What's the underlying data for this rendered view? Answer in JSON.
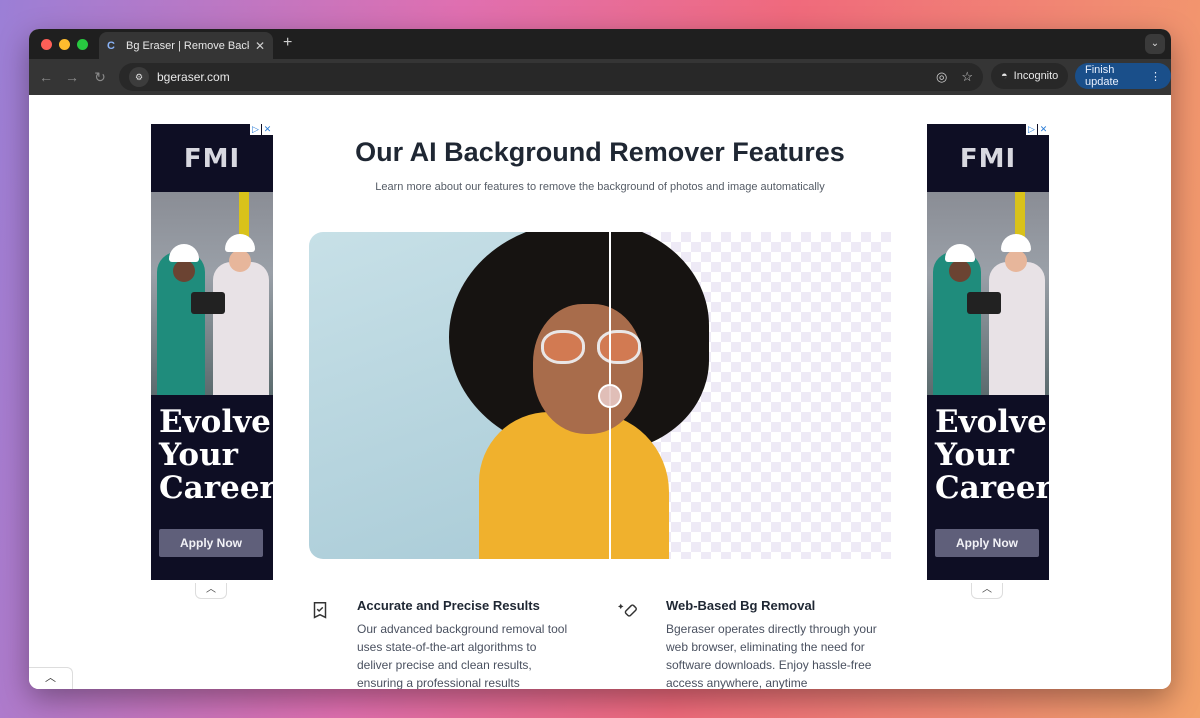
{
  "browser": {
    "tab_title": "Bg Eraser | Remove Backgrou",
    "tab_close": "✕",
    "new_tab": "+",
    "url": "bgeraser.com",
    "incognito_label": "Incognito",
    "finish_update_label": "Finish update"
  },
  "page": {
    "title": "Our AI Background Remover Features",
    "subtitle": "Learn more about our features to remove the background of photos and image automatically",
    "features": [
      {
        "icon": "badge-check-icon",
        "title": "Accurate and Precise Results",
        "text": "Our advanced background removal tool uses state-of-the-art algorithms to deliver precise and clean results, ensuring a professional results"
      },
      {
        "icon": "magic-eraser-icon",
        "title": "Web-Based Bg Removal",
        "text": "Bgeraser operates directly through your web browser, eliminating the need for software downloads. Enjoy hassle-free access anywhere, anytime"
      }
    ]
  },
  "ads": {
    "left": {
      "logo": "FMI",
      "headline": "Evolve Your Career",
      "button": "Apply Now"
    },
    "right": {
      "logo": "FMI",
      "headline": "Evolve Your Career",
      "button": "Apply Now"
    }
  },
  "colors": {
    "title_text": "#1f2733",
    "finish_update_bg": "#1a4f8a",
    "ad_bg": "#0e0e24"
  }
}
